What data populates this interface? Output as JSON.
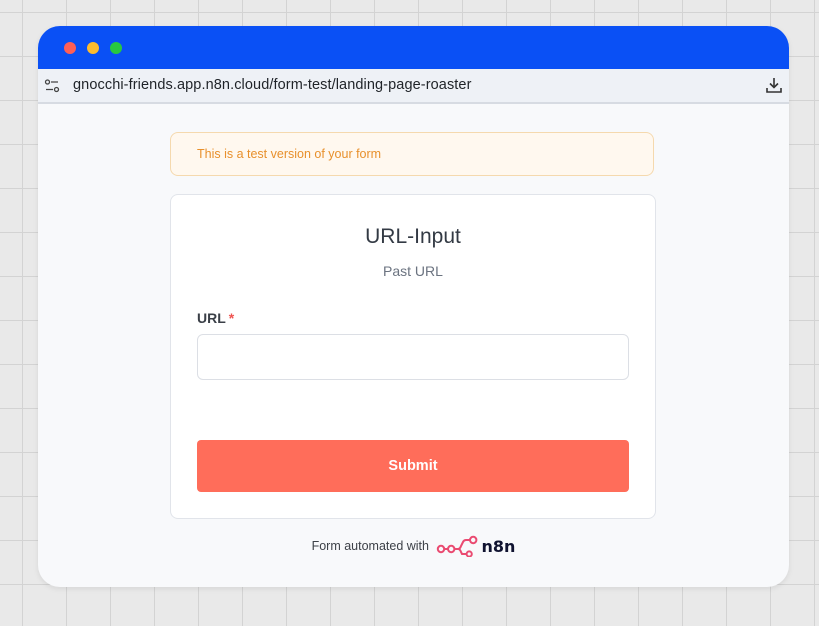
{
  "browser": {
    "url": "gnocchi-friends.app.n8n.cloud/form-test/landing-page-roaster",
    "colors": {
      "titlebar": "#0a50f5",
      "close": "#ff5f57",
      "minimize": "#febc2e",
      "maximize": "#28c840"
    }
  },
  "notice": {
    "text": "This is a test version of your form"
  },
  "form": {
    "title": "URL-Input",
    "subtitle": "Past URL",
    "field_label": "URL",
    "required_marker": "*",
    "url_value": "",
    "submit_label": "Submit",
    "accent_color": "#ff6d5a"
  },
  "footer": {
    "text": "Form automated with",
    "brand": "n8n",
    "brand_color": "#ea4b71"
  },
  "icons": [
    "site-settings-icon",
    "download-icon",
    "n8n-logo-icon"
  ]
}
